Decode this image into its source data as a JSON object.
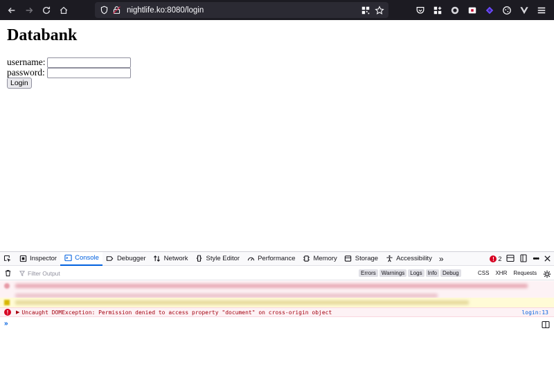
{
  "browser": {
    "url": "nightlife.ko:8080/login",
    "nav": {
      "back": "back-arrow-icon",
      "forward": "forward-arrow-icon",
      "reload": "reload-icon",
      "home": "home-icon"
    }
  },
  "page": {
    "title": "Databank",
    "form": {
      "username_label": "username:",
      "password_label": "password:",
      "username_value": "",
      "password_value": "",
      "login_label": "Login"
    }
  },
  "devtools": {
    "tabs": [
      {
        "label": "Inspector"
      },
      {
        "label": "Console"
      },
      {
        "label": "Debugger"
      },
      {
        "label": "Network"
      },
      {
        "label": "Style Editor"
      },
      {
        "label": "Performance"
      },
      {
        "label": "Memory"
      },
      {
        "label": "Storage"
      },
      {
        "label": "Accessibility"
      }
    ],
    "active_tab": "Console",
    "error_count": "2",
    "filter_placeholder": "Filter Output",
    "filter_buttons": [
      "Errors",
      "Warnings",
      "Logs",
      "Info",
      "Debug"
    ],
    "filter_right": [
      "CSS",
      "XHR",
      "Requests"
    ],
    "console_error": {
      "text": "Uncaught DOMException: Permission denied to access property \"document\" on cross-origin object",
      "source": "login:13"
    },
    "prompt": "»"
  },
  "colors": {
    "toolbar_bg": "#1c1b22",
    "accent": "#0060df",
    "error": "#d70022"
  }
}
